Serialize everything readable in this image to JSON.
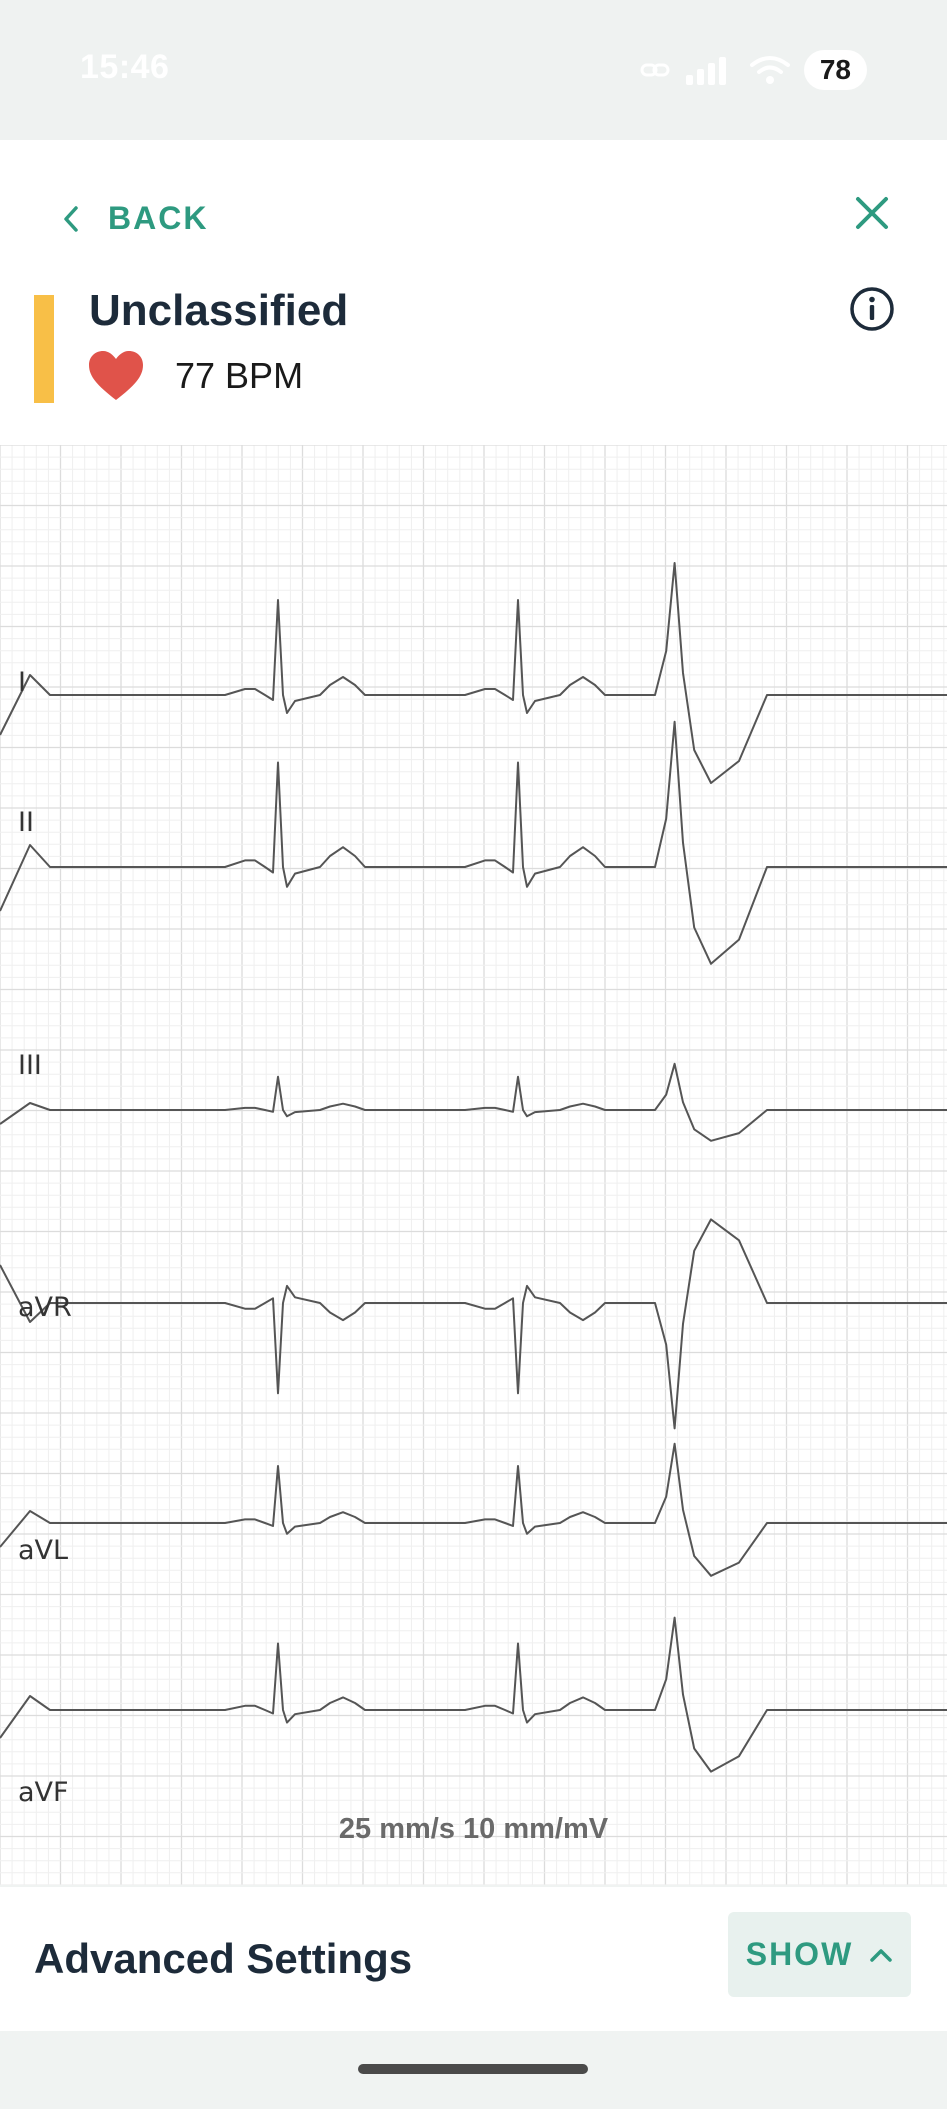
{
  "status_bar": {
    "time": "15:46",
    "battery": "78"
  },
  "header": {
    "back_label": "BACK",
    "title": "Unclassified",
    "heart_rate": "77 BPM",
    "accent_color": "#f8bf47",
    "brand_color": "#2e9a80",
    "heart_color": "#e0534a"
  },
  "ecg": {
    "leads": [
      "I",
      "II",
      "III",
      "aVR",
      "aVL",
      "aVF"
    ],
    "scale_text": "25 mm/s  10 mm/mV"
  },
  "advanced_settings": {
    "title": "Advanced Settings",
    "toggle_label": "SHOW"
  },
  "icons": [
    "chevron-left-icon",
    "close-icon",
    "info-icon",
    "heart-icon",
    "chevron-up-icon",
    "signal-icon",
    "wifi-icon",
    "link-icon"
  ]
}
